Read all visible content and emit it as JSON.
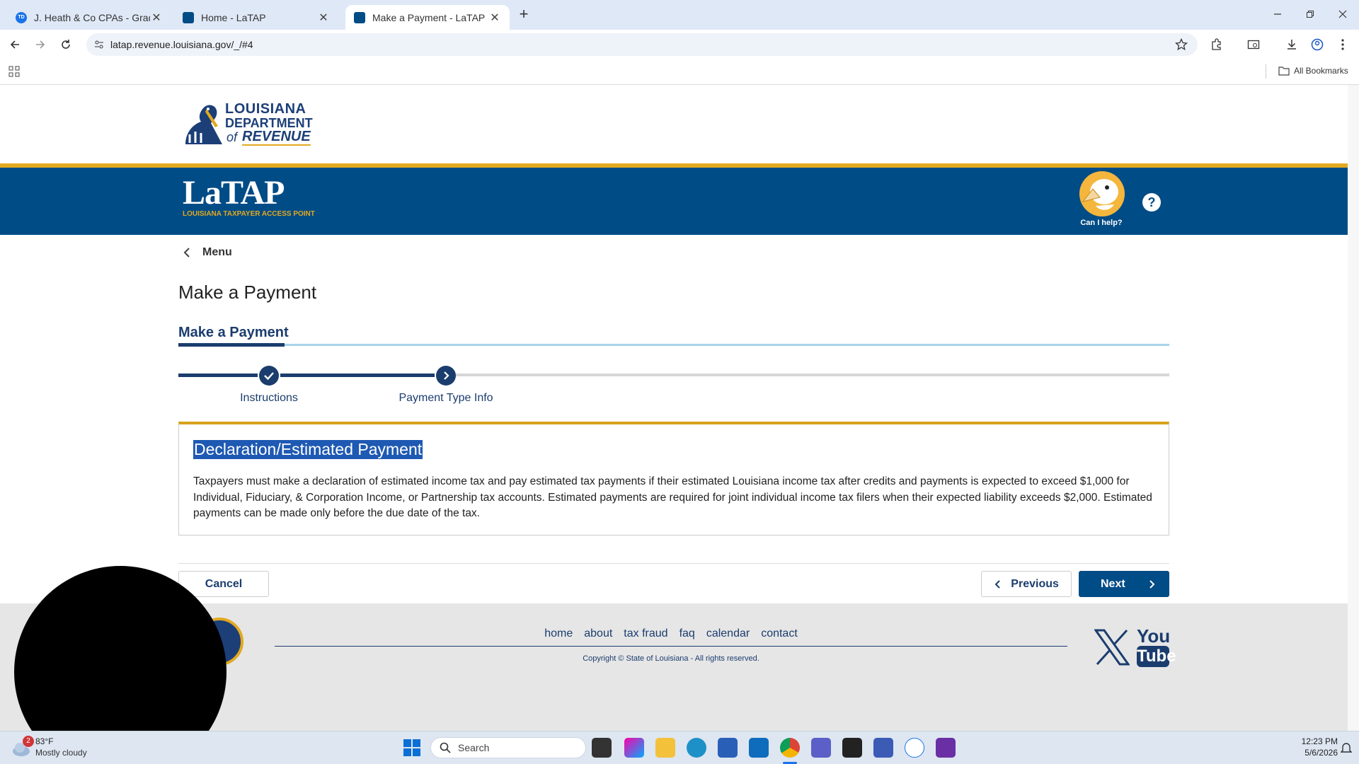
{
  "browser": {
    "tabs": [
      {
        "title": "J. Heath & Co CPAs - Grady, Su",
        "favicon": "td-favicon",
        "active": false
      },
      {
        "title": "Home - LaTAP",
        "favicon": "latap-favicon",
        "active": false
      },
      {
        "title": "Make a Payment - LaTAP",
        "favicon": "latap-favicon",
        "active": true
      }
    ],
    "url": "latap.revenue.louisiana.gov/_/#4",
    "all_bookmarks_label": "All Bookmarks"
  },
  "header": {
    "logo_top": "LOUISIANA",
    "logo_mid": "DEPARTMENT",
    "logo_of": "of",
    "logo_bottom": "REVENUE",
    "latap_logo": "LaTAP",
    "latap_tagline": "LOUISIANA TAXPAYER ACCESS POINT",
    "help_mascot_label": "Can I help?",
    "help_icon": "?"
  },
  "nav": {
    "menu_label": "Menu"
  },
  "main": {
    "page_title": "Make a Payment",
    "tab_label": "Make a Payment",
    "steps": [
      {
        "label": "Instructions",
        "status": "complete"
      },
      {
        "label": "Payment Type Info",
        "status": "current"
      }
    ],
    "section_heading": "Declaration/Estimated Payment",
    "description": "Taxpayers must make a declaration of estimated income tax and pay estimated tax payments if their estimated Louisiana income tax after credits and payments is expected to exceed $1,000 for Individual, Fiduciary, & Corporation Income, or Partnership tax accounts. Estimated payments are required for joint individual income tax filers when their expected liability exceeds $2,000. Estimated payments can be made only before the due date of the tax.",
    "cancel_label": "Cancel",
    "previous_label": "Previous",
    "next_label": "Next"
  },
  "footer": {
    "links": [
      "home",
      "about",
      "tax fraud",
      "faq",
      "calendar",
      "contact"
    ],
    "copyright": "Copyright © State of Louisiana - All rights reserved.",
    "youtube_top": "You",
    "youtube_bottom": "Tube"
  },
  "taskbar": {
    "weather_temp": "83°F",
    "weather_desc": "Mostly cloudy",
    "weather_badge": "2",
    "search_placeholder": "Search",
    "time": "12:23 PM",
    "date": "5/6/2026"
  },
  "colors": {
    "brand_blue": "#004c86",
    "accent_gold": "#e2a920",
    "link_blue": "#1b3d6e"
  }
}
